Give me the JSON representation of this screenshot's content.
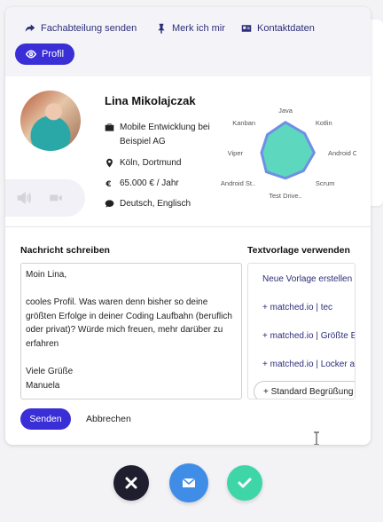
{
  "toolbar": {
    "forward_label": "Fachabteilung senden",
    "remember_label": "Merk ich mir",
    "contact_label": "Kontaktdaten",
    "profile_label": "Profil"
  },
  "profile": {
    "name": "Lina Mikolajczak",
    "job_line1": "Mobile Entwicklung bei",
    "job_line2": "Beispiel AG",
    "location": "Köln, Dortmund",
    "salary": "65.000 € / Jahr",
    "languages": "Deutsch, Englisch"
  },
  "skills_radar": {
    "labels": [
      "Java",
      "Kotlin",
      "Android OS",
      "Scrum",
      "Test Drive..",
      "Android St..",
      "Viper",
      "Kanban"
    ],
    "fill_color": "#4dd3b8",
    "outline_color": "#6f8fe6"
  },
  "message": {
    "section_title": "Nachricht schreiben",
    "body": "Moin Lina,\n\ncooles Profil. Was waren denn bisher so deine größten Erfolge in deiner Coding Laufbahn (beruflich oder privat)? Würde mich freuen, mehr darüber zu erfahren\n\nViele Grüße\nManuela",
    "send_label": "Senden",
    "cancel_label": "Abbrechen"
  },
  "templates": {
    "section_title": "Textvorlage verwenden",
    "items": [
      "Neue Vorlage erstellen",
      "+ matched.io | tec",
      "+ matched.io | Größte E",
      "+ matched.io | Locker a"
    ],
    "standard_label": "+ Standard Begrüßung"
  },
  "actions": {
    "reject_color": "#1e1e2e",
    "mail_color": "#3f8de6",
    "accept_color": "#3ed6a6"
  }
}
